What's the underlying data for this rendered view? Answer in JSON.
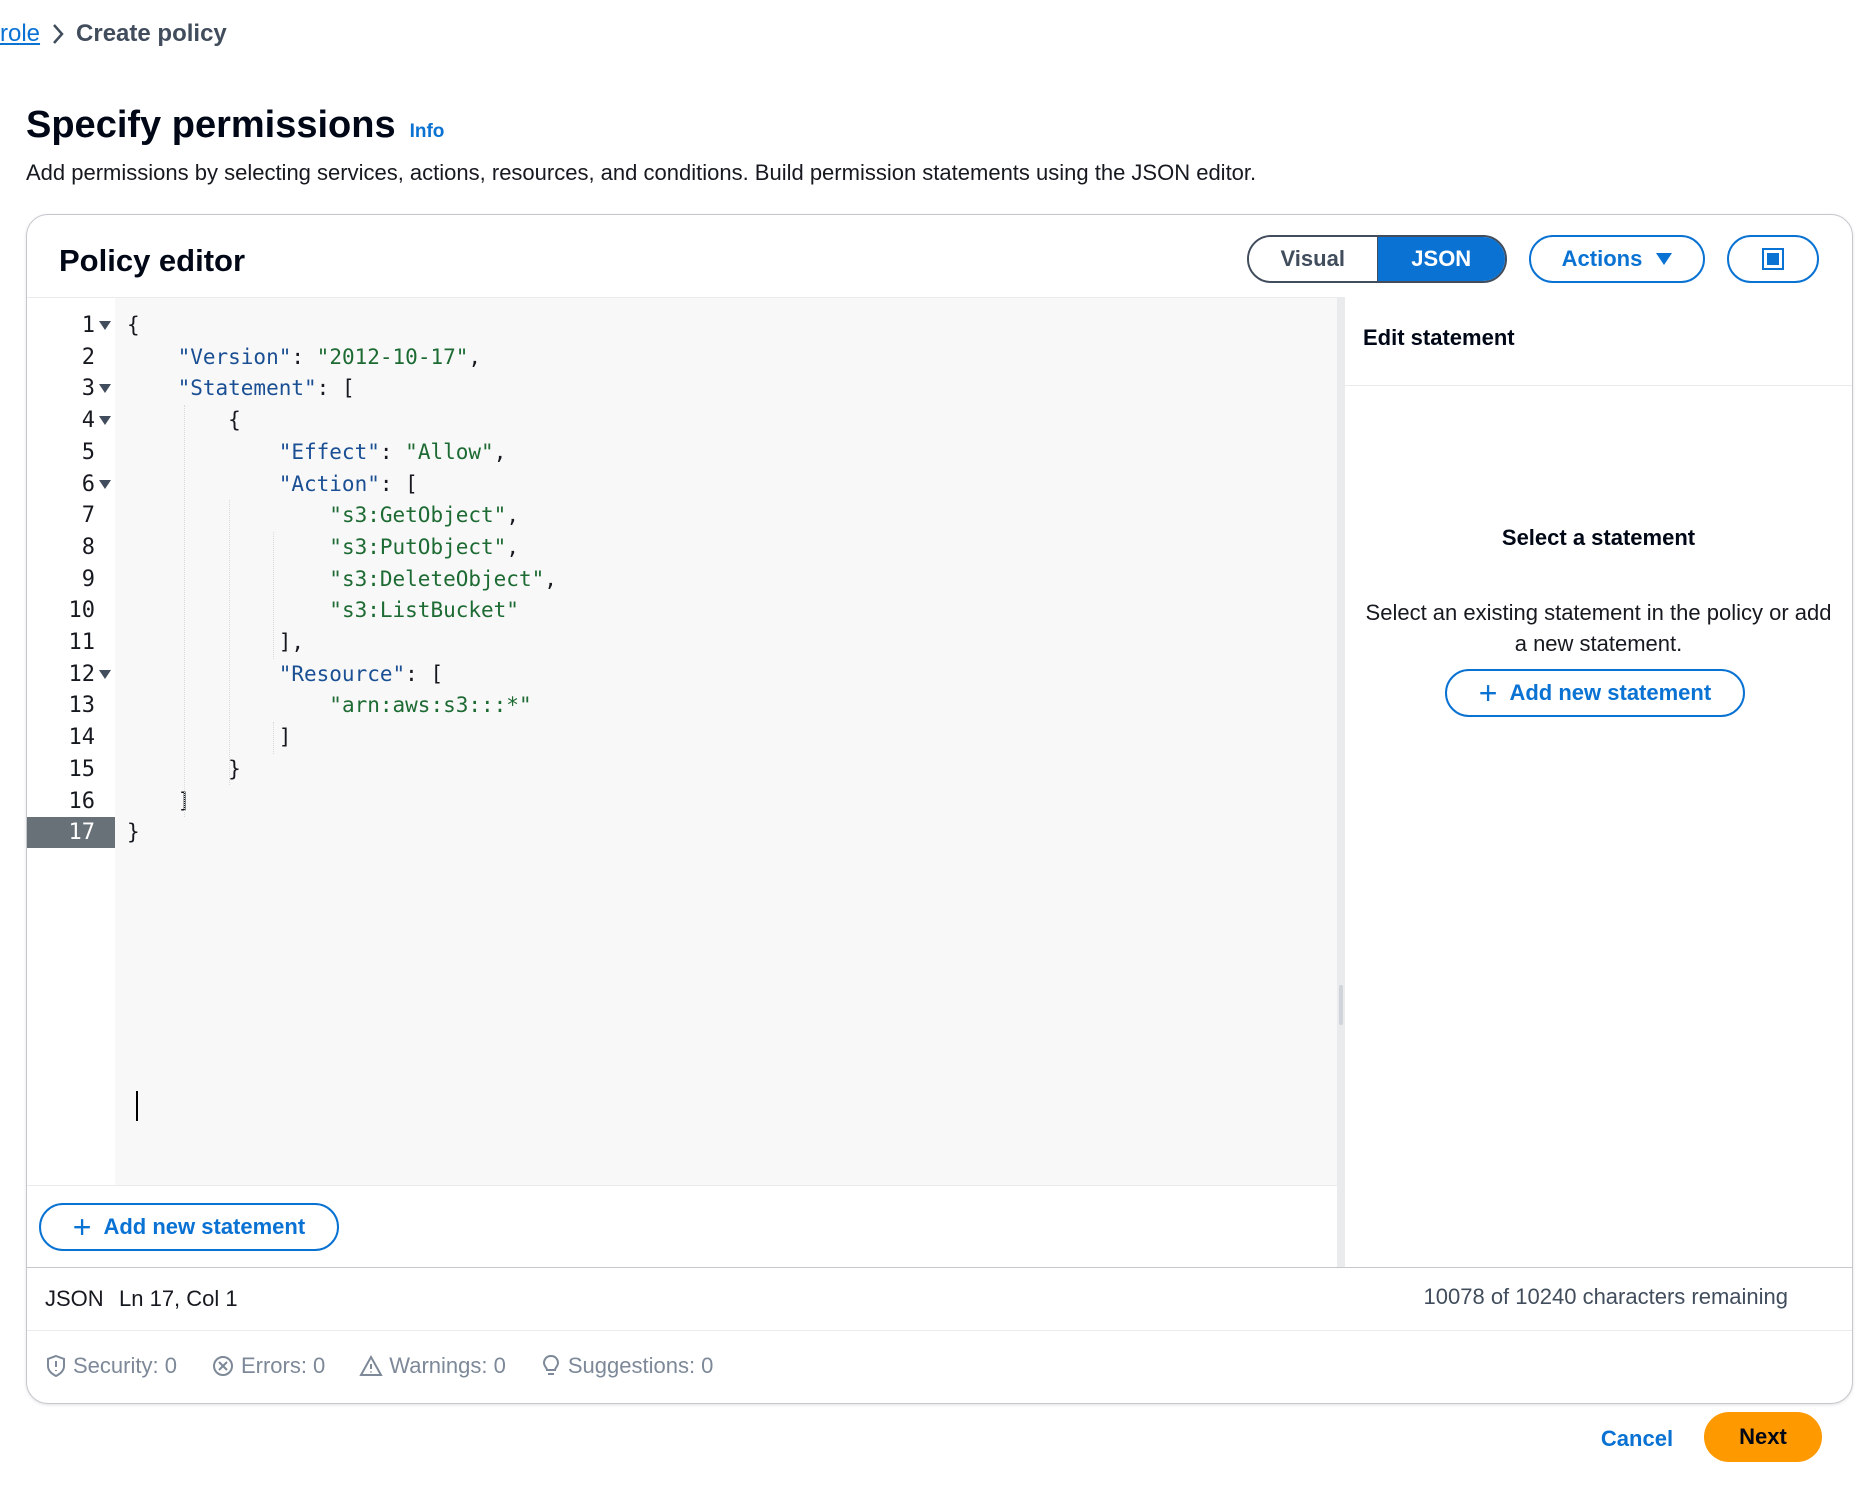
{
  "breadcrumb": {
    "parent": "role",
    "current": "Create policy"
  },
  "page": {
    "title": "Specify permissions",
    "info": "Info",
    "description": "Add permissions by selecting services, actions, resources, and conditions. Build permission statements using the JSON editor."
  },
  "editor": {
    "title": "Policy editor",
    "modes": {
      "visual": "Visual",
      "json": "JSON",
      "selected": "JSON"
    },
    "actions_label": "Actions",
    "add_statement_label": "Add new statement",
    "active_line": 17
  },
  "code_lines": [
    "{",
    "    \"Version\": \"2012-10-17\",",
    "    \"Statement\": [",
    "        {",
    "            \"Effect\": \"Allow\",",
    "            \"Action\": [",
    "                \"s3:GetObject\",",
    "                \"s3:PutObject\",",
    "                \"s3:DeleteObject\",",
    "                \"s3:ListBucket\"",
    "            ],",
    "            \"Resource\": [",
    "                \"arn:aws:s3:::*\"",
    "            ]",
    "        }",
    "    ]",
    "}"
  ],
  "line_numbers": [
    "1",
    "2",
    "3",
    "4",
    "5",
    "6",
    "7",
    "8",
    "9",
    "10",
    "11",
    "12",
    "13",
    "14",
    "15",
    "16",
    "17"
  ],
  "side_panel": {
    "title": "Edit statement",
    "empty_title": "Select a statement",
    "empty_desc": "Select an existing statement in the policy or add a new statement.",
    "add_statement_label": "Add new statement"
  },
  "status": {
    "mode": "JSON",
    "position": "Ln 17, Col 1",
    "chars_remaining": "10078 of 10240 characters remaining"
  },
  "validation": {
    "security": "Security: 0",
    "errors": "Errors: 0",
    "warnings": "Warnings: 0",
    "suggestions": "Suggestions: 0"
  },
  "footer": {
    "cancel": "Cancel",
    "next": "Next"
  },
  "colors": {
    "primary": "#0972d3",
    "next_button": "#ff9900",
    "active_gutter": "#687078"
  }
}
